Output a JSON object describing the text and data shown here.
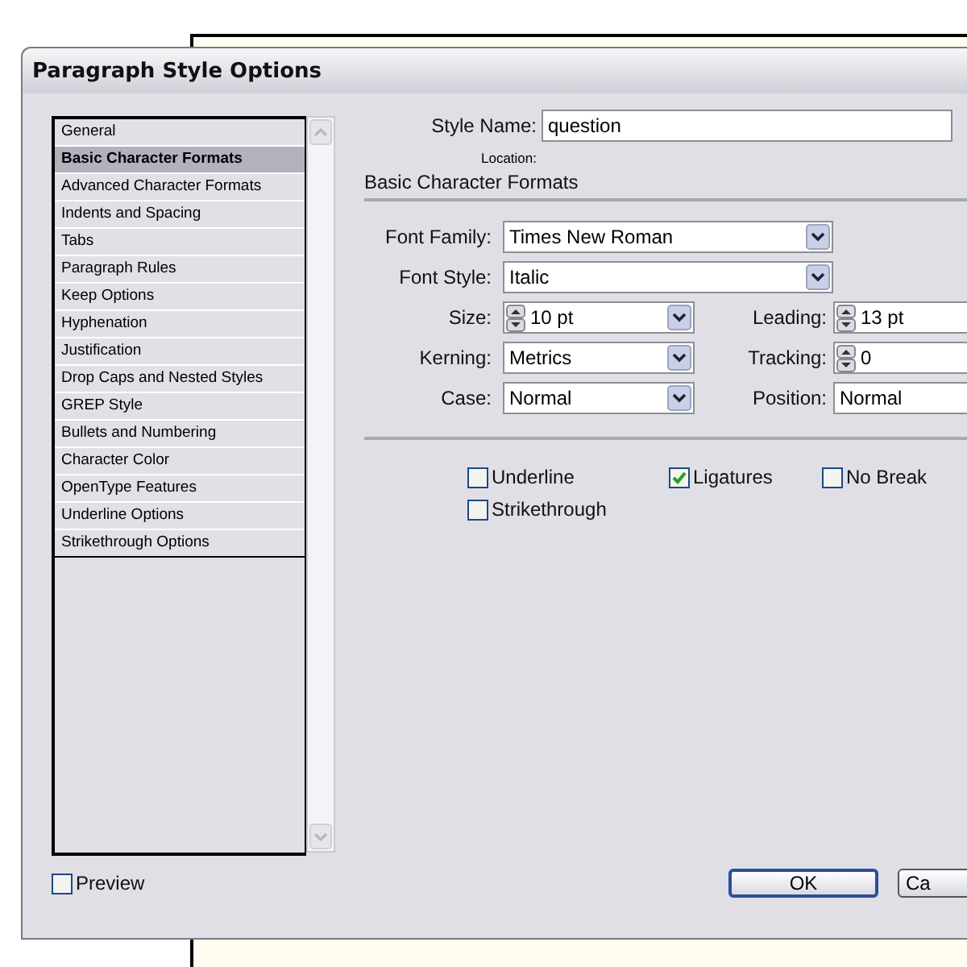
{
  "window": {
    "title": "Paragraph Style Options"
  },
  "sidebar": {
    "items": [
      {
        "label": "General",
        "selected": false
      },
      {
        "label": "Basic Character Formats",
        "selected": true
      },
      {
        "label": "Advanced Character Formats",
        "selected": false
      },
      {
        "label": "Indents and Spacing",
        "selected": false
      },
      {
        "label": "Tabs",
        "selected": false
      },
      {
        "label": "Paragraph Rules",
        "selected": false
      },
      {
        "label": "Keep Options",
        "selected": false
      },
      {
        "label": "Hyphenation",
        "selected": false
      },
      {
        "label": "Justification",
        "selected": false
      },
      {
        "label": "Drop Caps and Nested Styles",
        "selected": false
      },
      {
        "label": "GREP Style",
        "selected": false
      },
      {
        "label": "Bullets and Numbering",
        "selected": false
      },
      {
        "label": "Character Color",
        "selected": false
      },
      {
        "label": "OpenType Features",
        "selected": false
      },
      {
        "label": "Underline Options",
        "selected": false
      },
      {
        "label": "Strikethrough Options",
        "selected": false
      }
    ]
  },
  "style_name": {
    "label": "Style Name:",
    "value": "question"
  },
  "location": {
    "label": "Location:"
  },
  "section": {
    "title": "Basic Character Formats"
  },
  "rows": [
    [
      {
        "label": "Font Family:",
        "kind": "dropdown",
        "value": "Times New Roman"
      }
    ],
    [
      {
        "label": "Font Style:",
        "kind": "dropdown",
        "value": "Italic"
      }
    ],
    [
      {
        "label": "Size:",
        "kind": "spin-dropdown",
        "value": "10 pt"
      },
      {
        "label": "Leading:",
        "kind": "spin-dropdown",
        "value": "13 pt"
      }
    ],
    [
      {
        "label": "Kerning:",
        "kind": "dropdown",
        "value": "Metrics"
      },
      {
        "label": "Tracking:",
        "kind": "spin",
        "value": "0"
      }
    ],
    [
      {
        "label": "Case:",
        "kind": "dropdown",
        "value": "Normal"
      },
      {
        "label": "Position:",
        "kind": "dropdown",
        "value": "Normal"
      }
    ]
  ],
  "options": [
    [
      {
        "label": "Underline",
        "checked": false
      },
      {
        "label": "Ligatures",
        "checked": true
      },
      {
        "label": "No Break",
        "checked": false
      }
    ],
    [
      {
        "label": "Strikethrough",
        "checked": false
      }
    ]
  ],
  "preview": {
    "label": "Preview",
    "checked": false
  },
  "buttons": [
    {
      "label": "OK",
      "default": true
    },
    {
      "label": "Ca",
      "default": false
    }
  ]
}
